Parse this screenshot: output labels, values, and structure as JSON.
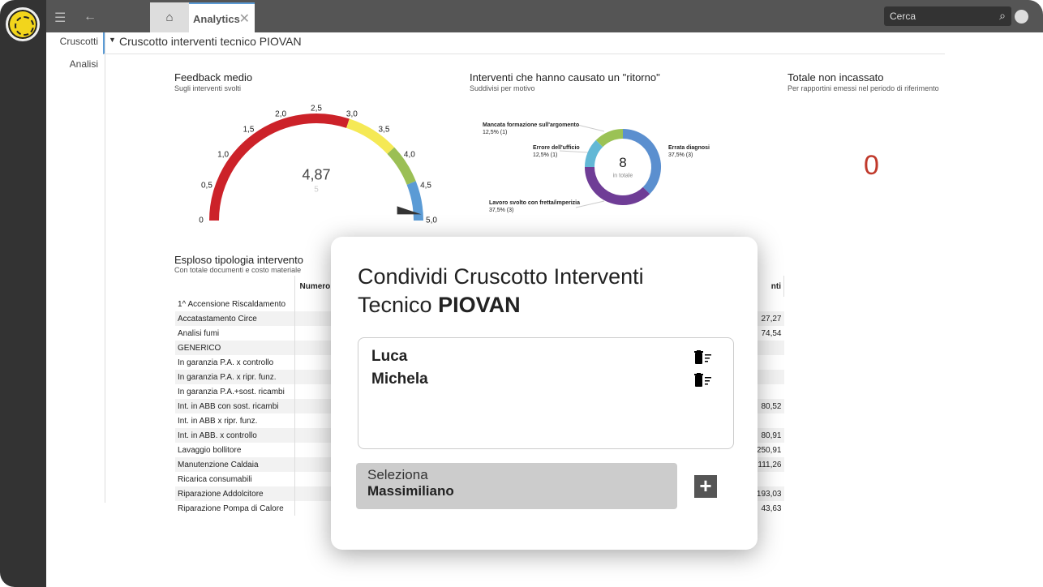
{
  "topbar": {
    "tab_analytics": "Analytics",
    "search_placeholder": "Cerca"
  },
  "sidebar": {
    "items": [
      {
        "label": "Cruscotti"
      },
      {
        "label": "Analisi"
      }
    ]
  },
  "breadcrumb": {
    "title": "Cruscotto interventi tecnico PIOVAN"
  },
  "widgets": {
    "feedback": {
      "title": "Feedback medio",
      "subtitle": "Sugli interventi svolti",
      "value": "4,87",
      "max_label": "5",
      "chart_data": {
        "type": "gauge",
        "min": 0,
        "max": 5,
        "value": 4.87,
        "ticks": [
          "0",
          "0,5",
          "1,0",
          "1,5",
          "2,0",
          "2,5",
          "3,0",
          "3,5",
          "4,0",
          "4,5",
          "5,0"
        ],
        "bands": [
          {
            "from": 0,
            "to": 3,
            "color": "#cc2229"
          },
          {
            "from": 3,
            "to": 3.8,
            "color": "#f5e955"
          },
          {
            "from": 3.8,
            "to": 4.4,
            "color": "#9bbf55"
          },
          {
            "from": 4.4,
            "to": 5,
            "color": "#5b9bd5"
          }
        ]
      }
    },
    "ritorno": {
      "title": "Interventi che hanno causato un \"ritorno\"",
      "subtitle": "Suddivisi per motivo",
      "total": "8",
      "total_label": "in totale",
      "chart_data": {
        "type": "pie",
        "slices": [
          {
            "label": "Errata diagnosi",
            "value": 3,
            "text": "37,5% (3)",
            "color": "#5b8fcf"
          },
          {
            "label": "Lavoro svolto con fretta/imperizia",
            "value": 3,
            "text": "37,5% (3)",
            "color": "#6f3d96"
          },
          {
            "label": "Errore dell'ufficio",
            "value": 1,
            "text": "12,5% (1)",
            "color": "#62b8d6"
          },
          {
            "label": "Mancata formazione sull'argomento",
            "value": 1,
            "text": "12,5% (1)",
            "color": "#9bc255"
          }
        ]
      }
    },
    "non_incassato": {
      "title": "Totale non incassato",
      "subtitle": "Per rapportini emessi nel periodo di riferimento",
      "value": "0"
    },
    "esploso": {
      "title": "Esploso tipologia intervento",
      "subtitle": "Con totale documenti e costo materiale",
      "headers": [
        "",
        "Numero",
        "nti"
      ],
      "rows": [
        [
          "1^ Accensione Riscaldamento",
          ""
        ],
        [
          "Accatastamento Circe",
          "27,27"
        ],
        [
          "Analisi fumi",
          "74,54"
        ],
        [
          "GENERICO",
          ""
        ],
        [
          "In garanzia P.A. x controllo",
          ""
        ],
        [
          "In garanzia P.A. x ripr. funz.",
          ""
        ],
        [
          "In garanzia P.A.+sost. ricambi",
          ""
        ],
        [
          "Int. in ABB con sost. ricambi",
          "80,52"
        ],
        [
          "Int. in ABB x ripr. funz.",
          ""
        ],
        [
          "Int. in ABB. x controllo",
          "80,91"
        ],
        [
          "Lavaggio bollitore",
          "250,91"
        ],
        [
          "Manutenzione Caldaia",
          "111,26"
        ],
        [
          "Ricarica consumabili",
          ""
        ],
        [
          "Riparazione Addolcitore",
          "193,03"
        ],
        [
          "Riparazione Pompa di Calore",
          "43,63"
        ]
      ]
    }
  },
  "modal": {
    "title_line1": "Condividi Cruscotto Interventi",
    "title_line2": "Tecnico ",
    "title_bold": "PIOVAN",
    "users": [
      "Luca",
      "Michela"
    ],
    "select_label": "Seleziona",
    "select_value": "Massimiliano"
  }
}
